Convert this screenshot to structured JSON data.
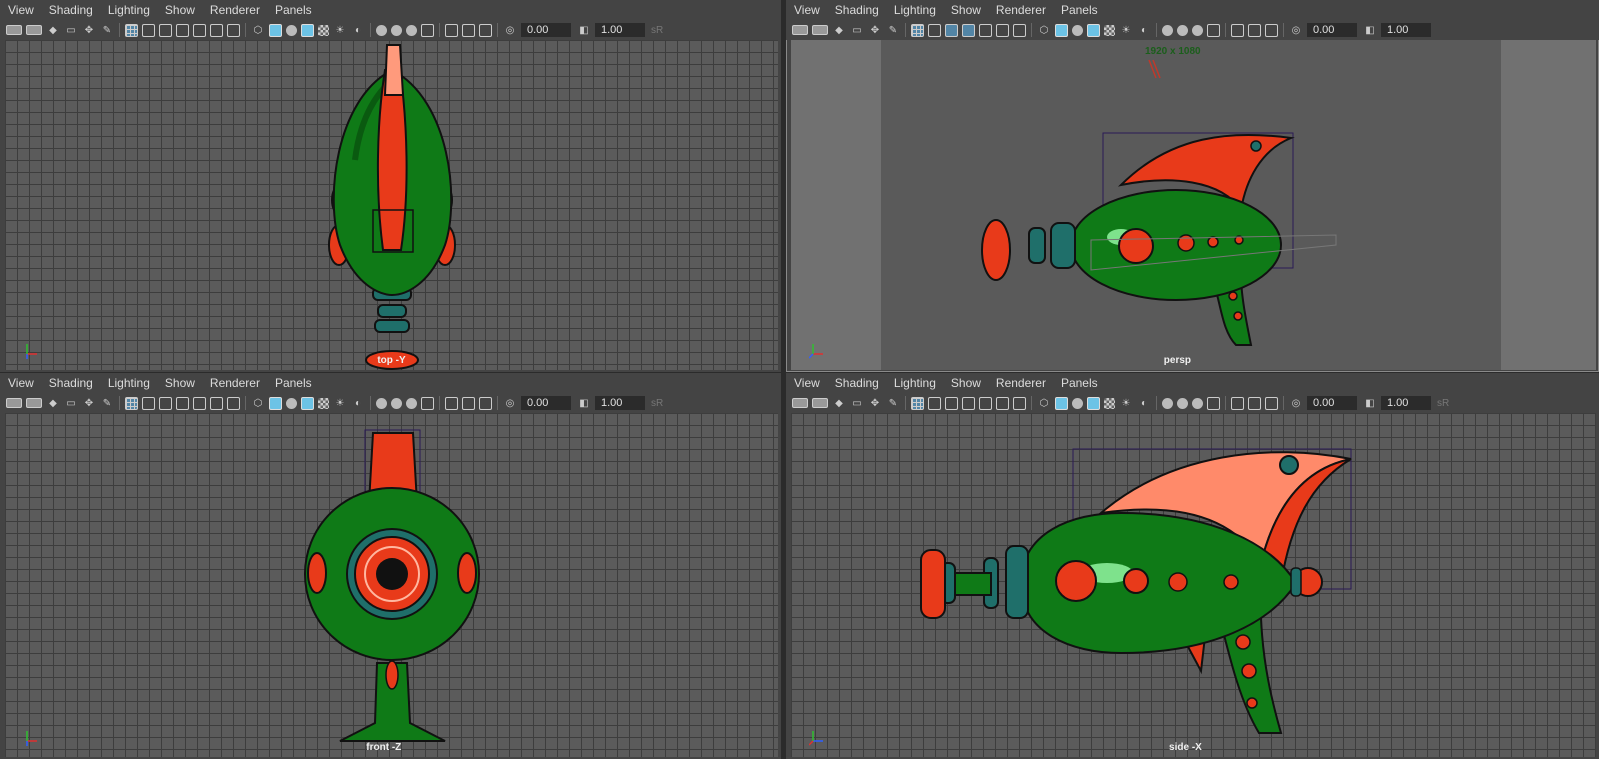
{
  "menus": [
    "View",
    "Shading",
    "Lighting",
    "Show",
    "Renderer",
    "Panels"
  ],
  "toolbar": {
    "field1": "0.00",
    "field2": "1.00",
    "trail_text": "sR"
  },
  "viewports": {
    "top": {
      "camera_label": "top -Y"
    },
    "persp": {
      "camera_label": "persp",
      "resolution_gate": "1920 x 1080"
    },
    "front": {
      "camera_label": "front -Z"
    },
    "side": {
      "camera_label": "side -X"
    }
  },
  "axis_labels": {
    "x": "x",
    "y": "y",
    "z": "z"
  },
  "colors": {
    "background": "#5b5b5b",
    "grid": "#3d3d3d",
    "accent": "#5285a6",
    "model_green": "#0f7a17",
    "model_red": "#e83a1a",
    "model_teal": "#1f6f6a"
  }
}
